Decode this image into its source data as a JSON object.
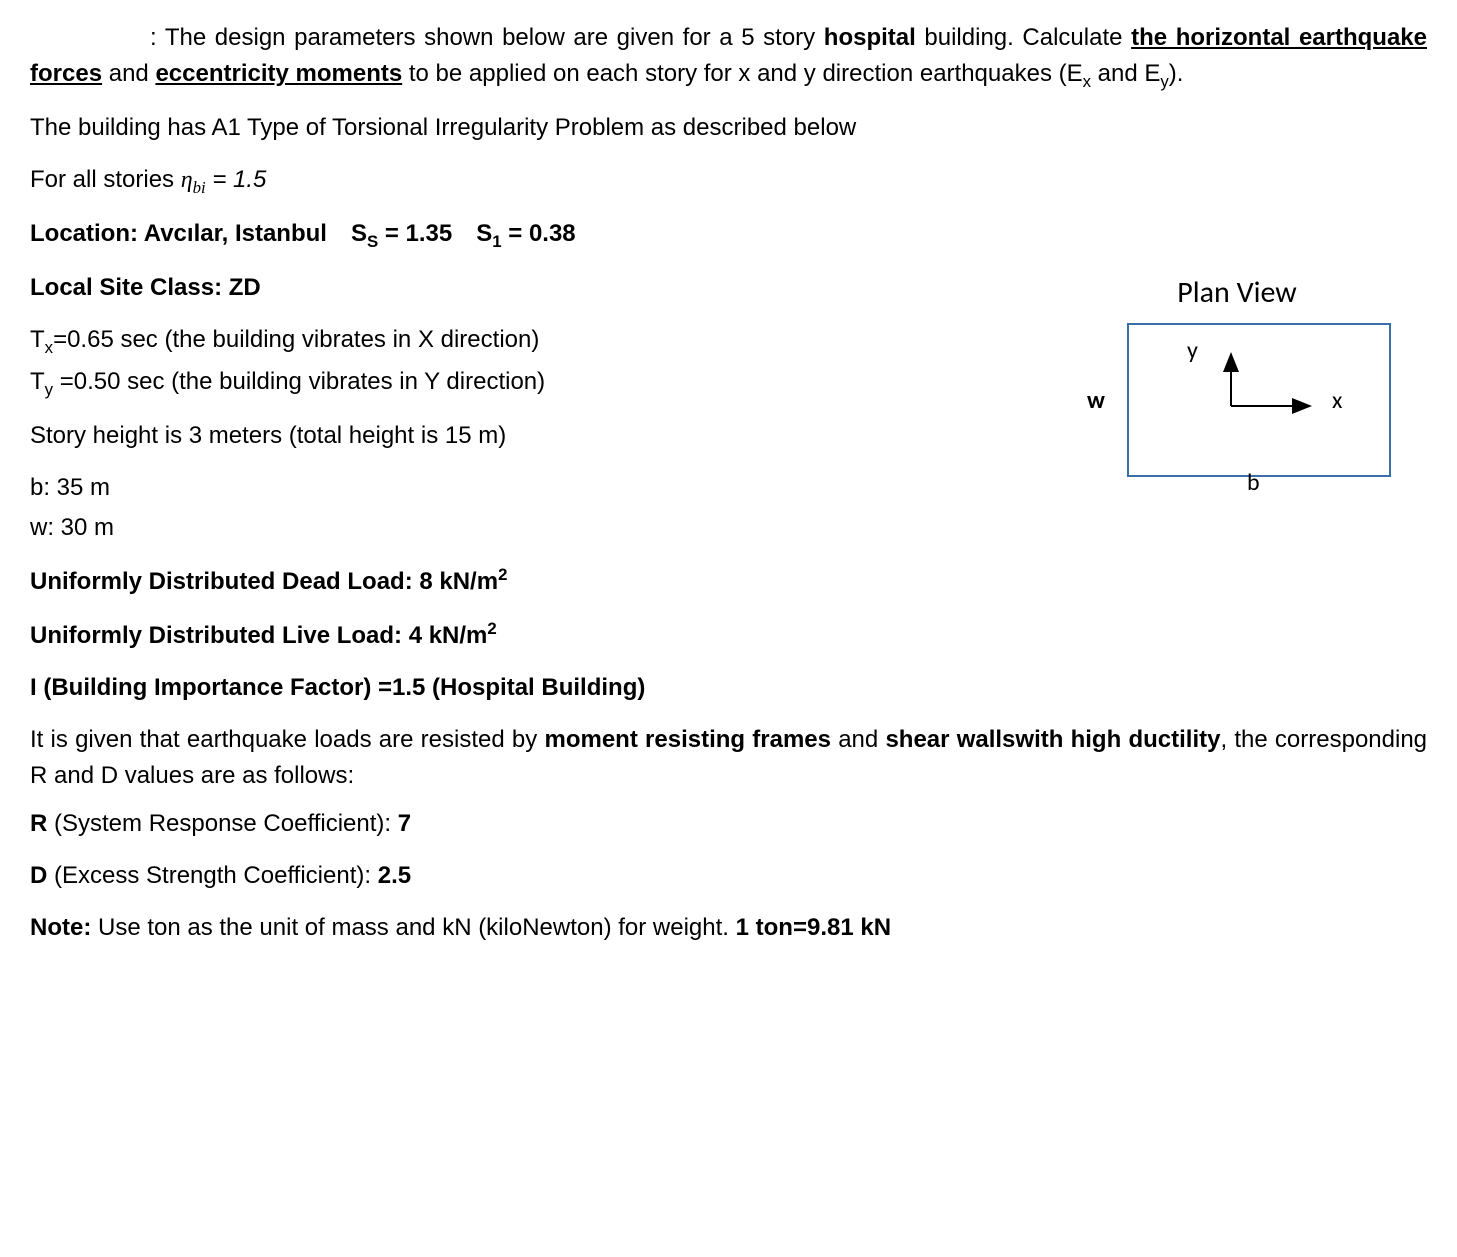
{
  "intro": {
    "prefix": ": ",
    "l1a": "The design parameters shown below are given for a 5 story ",
    "l1b_bold": "hospital",
    "l1c": " building.",
    "l2a": "Calculate ",
    "l2b_bu": "the horizontal earthquake forces",
    "l2c": " and ",
    "l2d_bu": "eccentricity moments",
    "l2e": " to be applied on each story for x and y direction earthquakes (E",
    "l2f": " and E",
    "l2g": ")."
  },
  "a1_line": "The building has A1 Type of Torsional Irregularity Problem as described below",
  "eta_line": {
    "a": "For all stories  ",
    "sym": "η",
    "sub": "bi",
    "eq": " = 1.5"
  },
  "location": {
    "a": "Location: Avcılar, Istanbul",
    "ss_label": "S",
    "ss_sub": "S",
    "ss_val": " = 1.35",
    "s1_label": "S",
    "s1_sub": "1",
    "s1_val": " = 0.38"
  },
  "site_class": "Local Site Class: ZD",
  "tx": {
    "a": "T",
    "sub": "x",
    "b": "=0.65 sec (the building vibrates in X direction)"
  },
  "ty": {
    "a": "T",
    "sub": "y",
    "b": " =0.50 sec (the building vibrates in Y direction)"
  },
  "story_height": "Story height is 3 meters (total height is 15 m)",
  "dim_b": "b: 35 m",
  "dim_w": "w: 30 m",
  "dead_load": {
    "a": "Uniformly Distributed Dead Load: 8 kN/m",
    "sup": "2"
  },
  "live_load": {
    "a": "Uniformly Distributed Live Load: 4 kN/m",
    "sup": "2"
  },
  "importance": "I (Building Importance Factor) =1.5 (Hospital Building)",
  "resist": {
    "a": "It is given that earthquake loads are resisted by ",
    "b_bold": "moment resisting frames",
    "c": " and ",
    "d_bold": "shear wallswith high ductility",
    "e": ", the corresponding R and D values are as follows:"
  },
  "r_line": {
    "a": "R",
    "b": " (System Response Coefficient): ",
    "c": "7"
  },
  "d_line": {
    "a": "D",
    "b": " (Excess Strength Coefficient):  ",
    "c": "2.5"
  },
  "note": {
    "a": "Note:",
    "b": " Use ton as the unit of mass and kN (kiloNewton) for weight. ",
    "c": "1 ton=9.81 kN"
  },
  "plan": {
    "title": "Plan View",
    "w": "w",
    "b": "b",
    "y": "y",
    "x": "x"
  }
}
